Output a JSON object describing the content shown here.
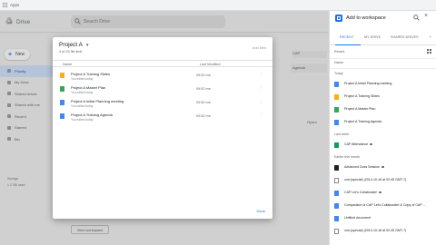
{
  "chrome": {
    "apps_label": "Apps"
  },
  "drive": {
    "title": "Drive",
    "search_placeholder": "Search Drive",
    "new_label": "New",
    "nav": [
      {
        "label": "Priority",
        "active": true
      },
      {
        "label": "My Drive"
      },
      {
        "label": "Shared drives"
      },
      {
        "label": "Shared with me"
      },
      {
        "label": "Recent"
      },
      {
        "label": "Starred"
      },
      {
        "label": "Bin"
      }
    ],
    "storage_label": "Storage",
    "storage_used": "1.2 GB used",
    "bg_card_label": "CAP",
    "bg_file_label": "Agenda",
    "bg_file2_label": "Opzm",
    "view_workspace_label": "View workspace"
  },
  "modal": {
    "title": "Project A",
    "subtitle": "4 of 25 file limit",
    "add_files_label": "Add files",
    "col_name": "Name",
    "col_last_modified": "Last Modified",
    "rows": [
      {
        "name": "Project A Training Slides",
        "edited": "You edited today",
        "modified": "09:52 me",
        "type": "slides"
      },
      {
        "name": "Project A Master Plan",
        "edited": "You edited today",
        "modified": "09:52 me",
        "type": "sheets"
      },
      {
        "name": "Project A Initial Planning meeting",
        "edited": "You edited today",
        "modified": "09:52 me",
        "type": "docs"
      },
      {
        "name": "Project A Training Agenda",
        "edited": "You edited today",
        "modified": "09:52 me",
        "type": "docs"
      }
    ],
    "done_label": "Done"
  },
  "panel": {
    "title": "Add to workspace",
    "tabs": [
      "RECENT",
      "MY DRIVE",
      "SHARED DRIVES"
    ],
    "active_tab": "RECENT",
    "sort_label": "Recent",
    "name_header": "Name",
    "sections": [
      {
        "label": "Today",
        "items": [
          {
            "name": "Project A Initial Planning meeting",
            "type": "gd"
          },
          {
            "name": "Project A Training Slides",
            "type": "gsl"
          },
          {
            "name": "Project A Master Plan",
            "type": "gs"
          },
          {
            "name": "Project A Training Agenda",
            "type": "gd"
          }
        ]
      },
      {
        "label": "Last week",
        "items": [
          {
            "name": "CAP Attendance",
            "type": "grn",
            "shared": true
          }
        ]
      },
      {
        "label": "Earlier this month",
        "items": [
          {
            "name": "Advanced Docs Session",
            "type": "dark",
            "shared": true
          },
          {
            "name": "vori-(special) (2014-10-16 at 02:45 GMT-7)",
            "type": "doc"
          },
          {
            "name": "CAP Let's Collaborate!",
            "type": "gd",
            "shared": true
          },
          {
            "name": "Comparison of CAP Let's Collaborate! & Copy of CAP ...",
            "type": "gd"
          },
          {
            "name": "Untitled document",
            "type": "gd"
          },
          {
            "name": "vori-(special) (2014-10-16 at 02:45 GMT-7)",
            "type": "doc"
          }
        ]
      }
    ]
  }
}
